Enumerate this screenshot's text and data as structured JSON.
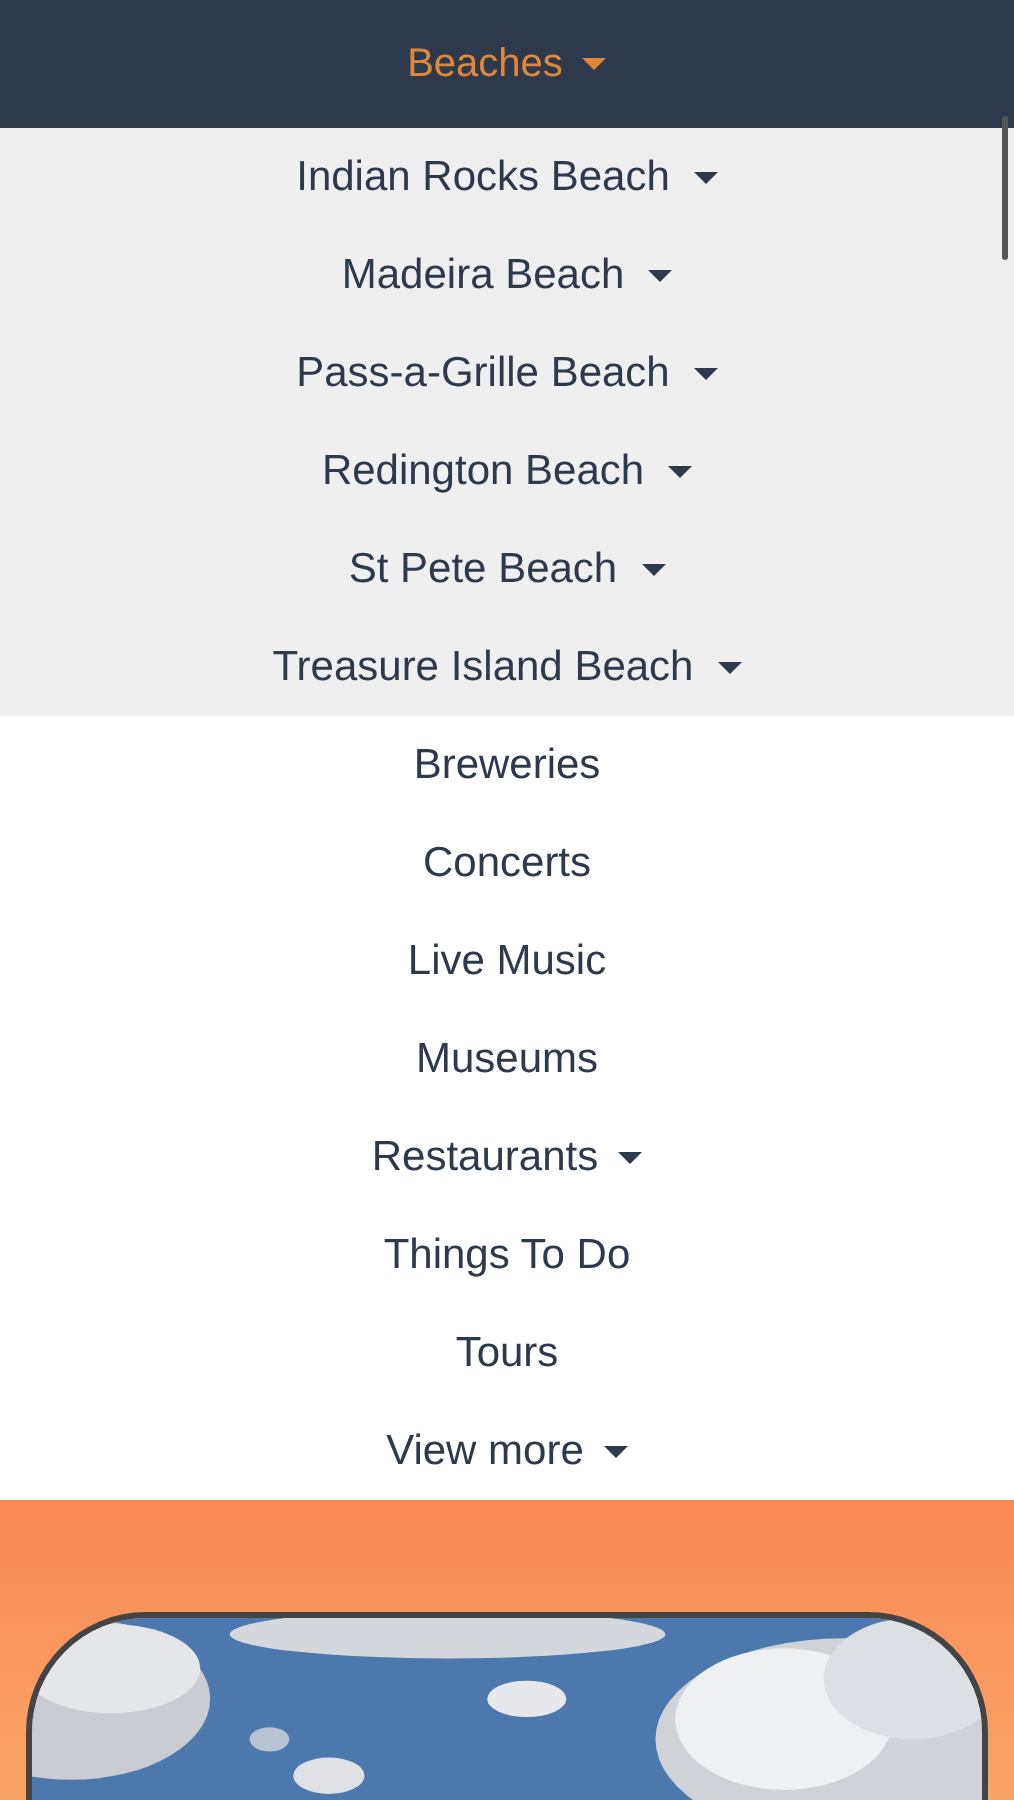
{
  "menu": {
    "label": "Beaches",
    "has_caret": true,
    "expanded": true,
    "submenu": [
      {
        "label": "Indian Rocks Beach",
        "has_caret": true
      },
      {
        "label": "Madeira Beach",
        "has_caret": true
      },
      {
        "label": "Pass-a-Grille Beach",
        "has_caret": true
      },
      {
        "label": "Redington Beach",
        "has_caret": true
      },
      {
        "label": "St Pete Beach",
        "has_caret": true
      },
      {
        "label": "Treasure Island Beach",
        "has_caret": true
      }
    ]
  },
  "items": [
    {
      "label": "Breweries",
      "has_caret": false
    },
    {
      "label": "Concerts",
      "has_caret": false
    },
    {
      "label": "Live Music",
      "has_caret": false
    },
    {
      "label": "Museums",
      "has_caret": false
    },
    {
      "label": "Restaurants",
      "has_caret": true
    },
    {
      "label": "Things To Do",
      "has_caret": false
    },
    {
      "label": "Tours",
      "has_caret": false
    },
    {
      "label": "View more",
      "has_caret": true
    }
  ]
}
